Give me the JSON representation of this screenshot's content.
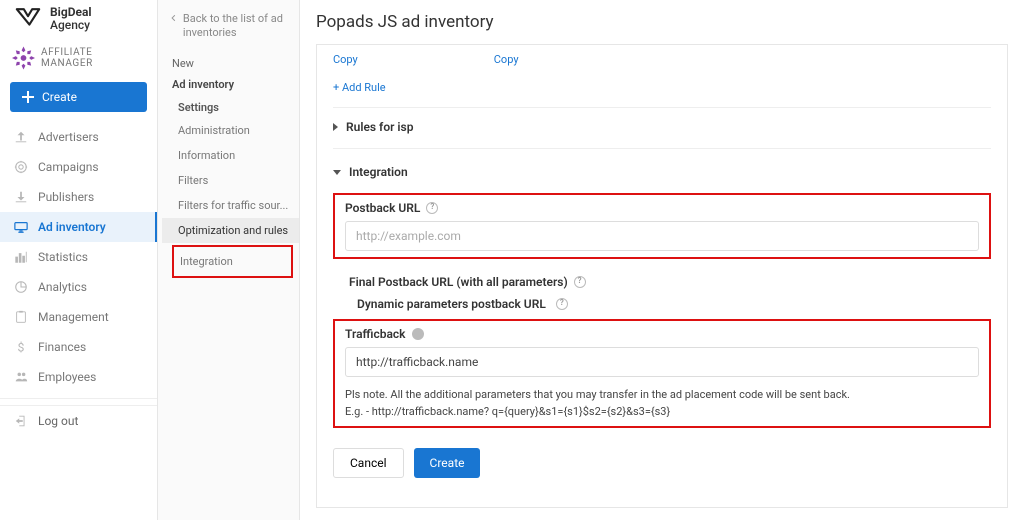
{
  "brand": {
    "line1": "BigDeal",
    "line2": "Agency"
  },
  "affiliate_label": "AFFILIATE MANAGER",
  "create_label": "Create",
  "nav": [
    {
      "id": "advertisers",
      "label": "Advertisers"
    },
    {
      "id": "campaigns",
      "label": "Campaigns"
    },
    {
      "id": "publishers",
      "label": "Publishers"
    },
    {
      "id": "ad-inventory",
      "label": "Ad inventory"
    },
    {
      "id": "statistics",
      "label": "Statistics"
    },
    {
      "id": "analytics",
      "label": "Analytics"
    },
    {
      "id": "management",
      "label": "Management"
    },
    {
      "id": "finances",
      "label": "Finances"
    },
    {
      "id": "employees",
      "label": "Employees"
    }
  ],
  "logout_label": "Log out",
  "subnav": {
    "back": "Back to the list of ad inventories",
    "new_label": "New",
    "ad_inv_label": "Ad inventory",
    "settings_label": "Settings",
    "items": [
      "Administration",
      "Information",
      "Filters",
      "Filters for traffic sour...",
      "Optimization and rules",
      "Integration"
    ]
  },
  "page": {
    "title": "Popads JS ad inventory",
    "copy_label": "Copy",
    "add_rule": "+ Add Rule",
    "rules_isp": "Rules for isp",
    "integration_title": "Integration",
    "postback_label": "Postback URL",
    "postback_placeholder": "http://example.com",
    "final_postback_label": "Final Postback URL (with all parameters)",
    "dyn_params_label": "Dynamic parameters postback URL",
    "trafficback_label": "Trafficback",
    "trafficback_value": "http://trafficback.name",
    "note_line1": "Pls note. All the additional parameters that you may transfer in the ad placement code will be sent back.",
    "note_line2": "E.g. - http://trafficback.name? q={query}&s1={s1}$s2={s2}&s3={s3}",
    "cancel": "Cancel",
    "create": "Create"
  }
}
